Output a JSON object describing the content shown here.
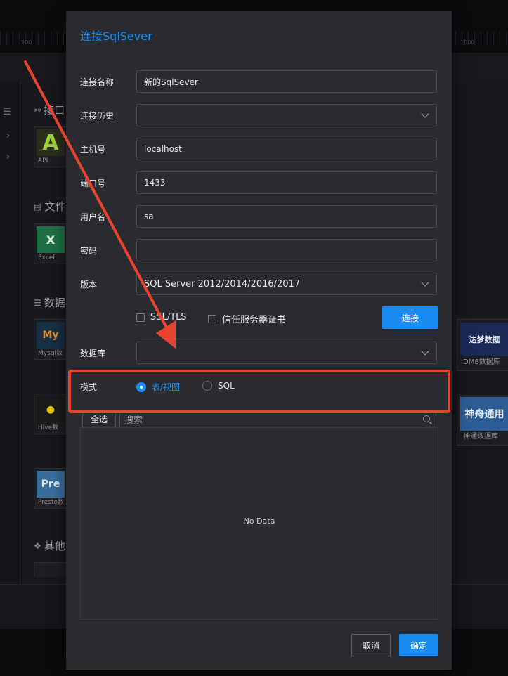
{
  "background": {
    "sections": [
      {
        "label": "接口",
        "icon": "link-icon"
      },
      {
        "label": "文件",
        "icon": "file-icon"
      },
      {
        "label": "数据",
        "icon": "database-icon"
      },
      {
        "label": "其他",
        "icon": "grid-icon"
      }
    ],
    "cards": {
      "api": {
        "caption": "API",
        "glyph": "A"
      },
      "excel": {
        "caption": "Excel",
        "glyph": "X"
      },
      "mysql": {
        "caption": "Mysql数",
        "glyph": "My"
      },
      "hive": {
        "caption": "Hive数",
        "glyph": ""
      },
      "presto": {
        "caption": "Presto数",
        "glyph": "Pre"
      },
      "dm8": {
        "caption": "DM8数据库",
        "glyph": "达梦数据"
      },
      "shentong": {
        "caption": "神通数据库",
        "glyph": "神舟通用"
      }
    },
    "ruler_labels": [
      "500",
      "1000"
    ],
    "colors": {
      "accent": "#1b8cf2",
      "annotation": "#e8432d"
    }
  },
  "modal": {
    "title": "连接SqlSever",
    "fields": {
      "name": {
        "label": "连接名称",
        "value": "新的SqlSever"
      },
      "history": {
        "label": "连接历史",
        "value": ""
      },
      "host": {
        "label": "主机号",
        "value": "localhost"
      },
      "port": {
        "label": "端口号",
        "value": "1433"
      },
      "user": {
        "label": "用户名",
        "value": "sa"
      },
      "password": {
        "label": "密码",
        "value": ""
      },
      "version": {
        "label": "版本",
        "value": "SQL Server 2012/2014/2016/2017"
      },
      "database": {
        "label": "数据库",
        "value": ""
      }
    },
    "ssl_label": "SSL/TLS",
    "trust_label": "信任服务器证书",
    "connect_label": "连接",
    "mode": {
      "label": "模式",
      "options": [
        {
          "label": "表/视图",
          "selected": true
        },
        {
          "label": "SQL",
          "selected": false
        }
      ]
    },
    "select_all_label": "全选",
    "search_placeholder": "搜索",
    "empty_text": "No Data",
    "cancel_label": "取消",
    "ok_label": "确定"
  }
}
